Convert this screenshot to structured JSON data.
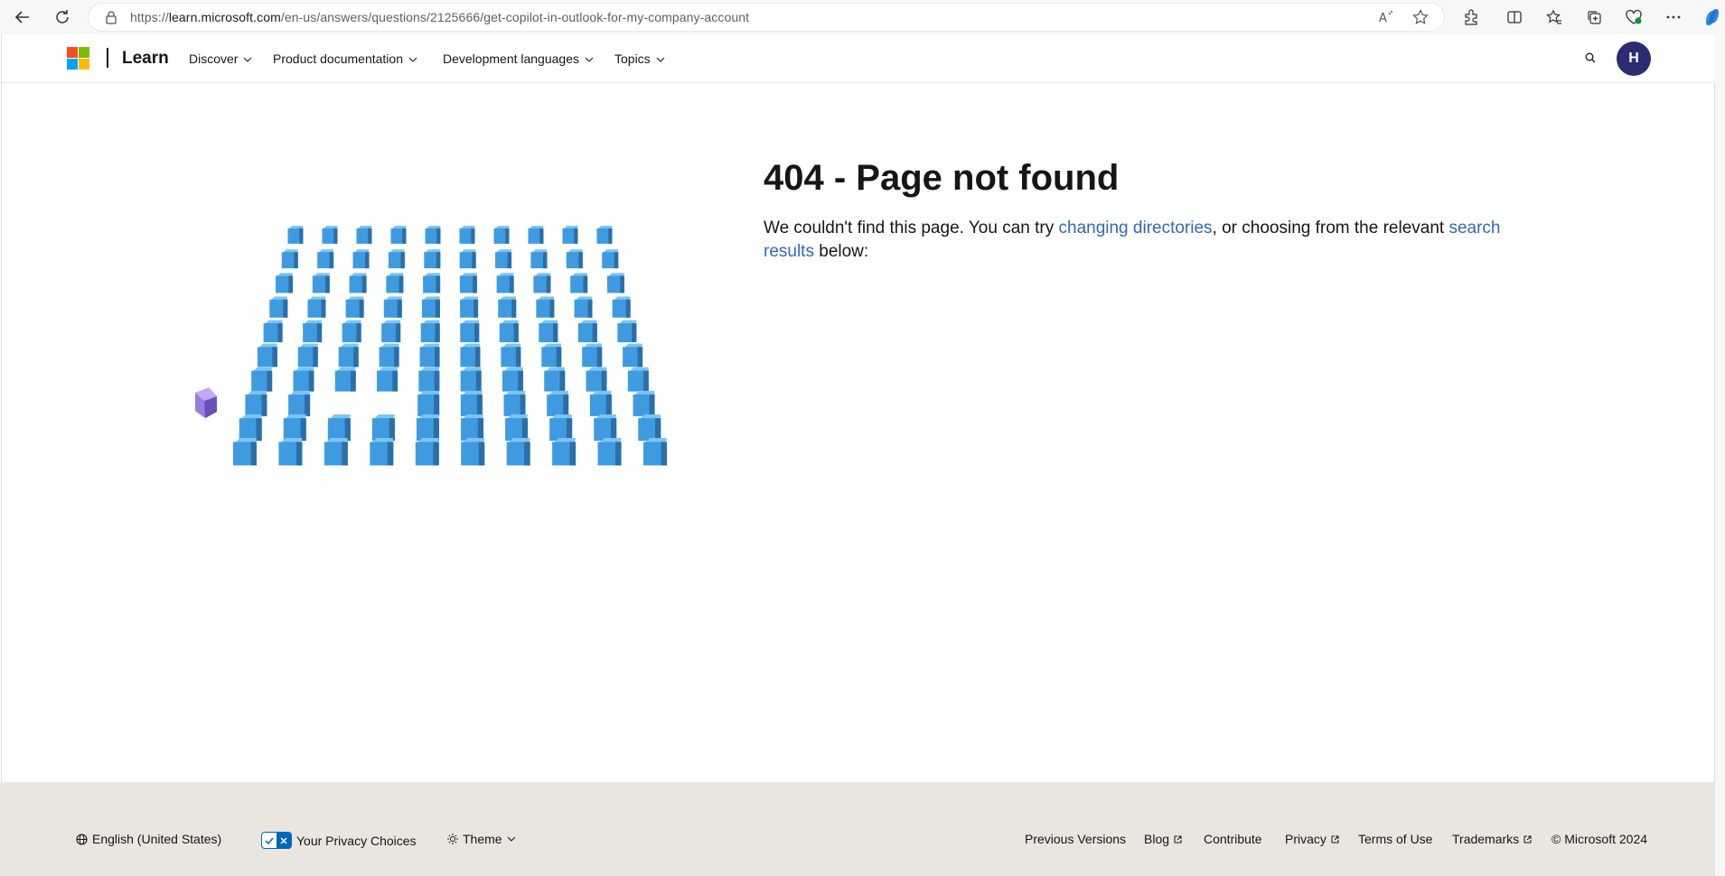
{
  "browser": {
    "url_prefix": "https://",
    "url_domain": "learn.microsoft.com",
    "url_path": "/en-us/answers/questions/2125666/get-copilot-in-outlook-for-my-company-account",
    "icons": [
      "back-icon",
      "refresh-icon",
      "lock-icon",
      "read-aloud-icon",
      "favorite-star-icon",
      "extensions-icon",
      "split-screen-icon",
      "favorites-icon",
      "collections-icon",
      "browser-essentials-icon",
      "more-icon",
      "copilot-icon"
    ]
  },
  "header": {
    "brand": "Learn",
    "nav": [
      "Discover",
      "Product documentation",
      "Development languages",
      "Topics"
    ],
    "avatar_initial": "H"
  },
  "main": {
    "title": "404 - Page not found",
    "desc_before": "We couldn't find this page. You can try ",
    "link_directories": "changing directories",
    "desc_middle": ", or choosing from the relevant ",
    "link_search": "search results",
    "desc_after": " below:"
  },
  "footer": {
    "language": "English (United States)",
    "privacy_choices": "Your Privacy Choices",
    "theme": "Theme",
    "links": [
      "Previous Versions",
      "Blog",
      "Contribute",
      "Privacy",
      "Terms of Use",
      "Trademarks"
    ],
    "copyright": "© Microsoft 2024"
  },
  "colors": {
    "link": "#2e6bb1",
    "cube": "#3f9be0",
    "odd_cube": "#9b7ce0",
    "avatar": "#2a2d6f",
    "footer_bg": "#e8e6df"
  }
}
